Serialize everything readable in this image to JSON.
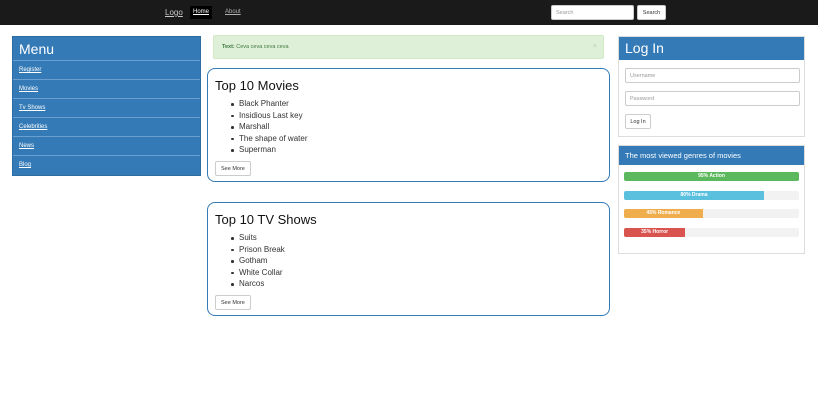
{
  "navbar": {
    "logo": "Logo",
    "links": [
      {
        "label": "Home",
        "active": true
      },
      {
        "label": "About",
        "active": false
      }
    ],
    "search": {
      "placeholder": "Search",
      "button": "Search"
    }
  },
  "menu": {
    "title": "Menu",
    "items": [
      "Register",
      "Movies",
      "Tv Shows",
      "Celebrities",
      "News",
      "Blog"
    ]
  },
  "alert": {
    "label": "Text:",
    "message": "Ceva ceva ceva ceva",
    "close": "×"
  },
  "movies": {
    "title": "Top 10 Movies",
    "items": [
      "Black Phanter",
      "Insidious Last key",
      "Marshall",
      "The shape of water",
      "Superman"
    ],
    "button": "See More"
  },
  "tv": {
    "title": "Top 10 TV Shows",
    "items": [
      "Suits",
      "Prison Break",
      "Gotham",
      "White Collar",
      "Narcos"
    ],
    "button": "See More"
  },
  "login": {
    "title": "Log In",
    "username_placeholder": "Username",
    "password_placeholder": "Password",
    "button": "Log In"
  },
  "genres": {
    "title": "The most viewed genres of movies",
    "bars": [
      {
        "label": "95% Action",
        "percent": 100,
        "color": "#5cb85c"
      },
      {
        "label": "80% Drama",
        "percent": 80,
        "color": "#5bc0de"
      },
      {
        "label": "45% Romance",
        "percent": 45,
        "color": "#f0ad4e"
      },
      {
        "label": "35% Horror",
        "percent": 35,
        "color": "#d9534f"
      }
    ]
  }
}
